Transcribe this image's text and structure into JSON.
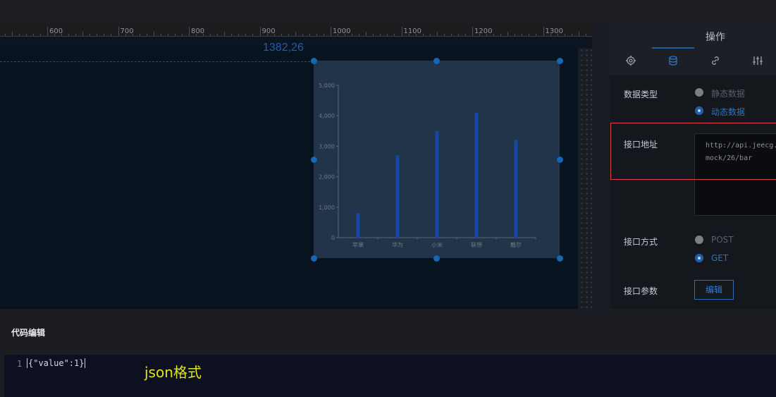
{
  "ruler": {
    "labels": [
      "600",
      "700",
      "800",
      "900",
      "1000",
      "1100",
      "1200",
      "1300"
    ]
  },
  "canvas": {
    "coordinate_readout": "1382,26"
  },
  "chart_data": {
    "type": "bar",
    "categories": [
      "苹果",
      "华为",
      "小米",
      "联想",
      "戴尔"
    ],
    "values": [
      800,
      2700,
      3500,
      4100,
      3200
    ],
    "ylim": [
      0,
      5000
    ],
    "y_ticks": [
      "5,000",
      "4,000",
      "3,000",
      "2,000",
      "1,000",
      "0"
    ],
    "bar_color": "#1647a6"
  },
  "panel": {
    "title": "操作",
    "tabs": [
      {
        "icon": "gear-icon"
      },
      {
        "icon": "database-icon"
      },
      {
        "icon": "link-icon"
      },
      {
        "icon": "sliders-icon"
      }
    ],
    "data_type": {
      "label": "数据类型",
      "options": [
        {
          "label": "静态数据",
          "selected": false
        },
        {
          "label": "动态数据",
          "selected": true
        }
      ]
    },
    "api_url": {
      "label": "接口地址",
      "value": "http://api.jeecg.\nmock/26/bar"
    },
    "api_method": {
      "label": "接口方式",
      "options": [
        {
          "label": "POST",
          "selected": false
        },
        {
          "label": "GET",
          "selected": true
        }
      ]
    },
    "api_params": {
      "label": "接口参数",
      "button": "编辑"
    }
  },
  "code_editor": {
    "title": "代码编辑",
    "line_number": "1",
    "code": "{\"value\":1}",
    "annotation": "json格式"
  },
  "colors": {
    "accent": "#1f5ea8",
    "highlight": "#d9414a",
    "annotation": "#e8e21a"
  }
}
